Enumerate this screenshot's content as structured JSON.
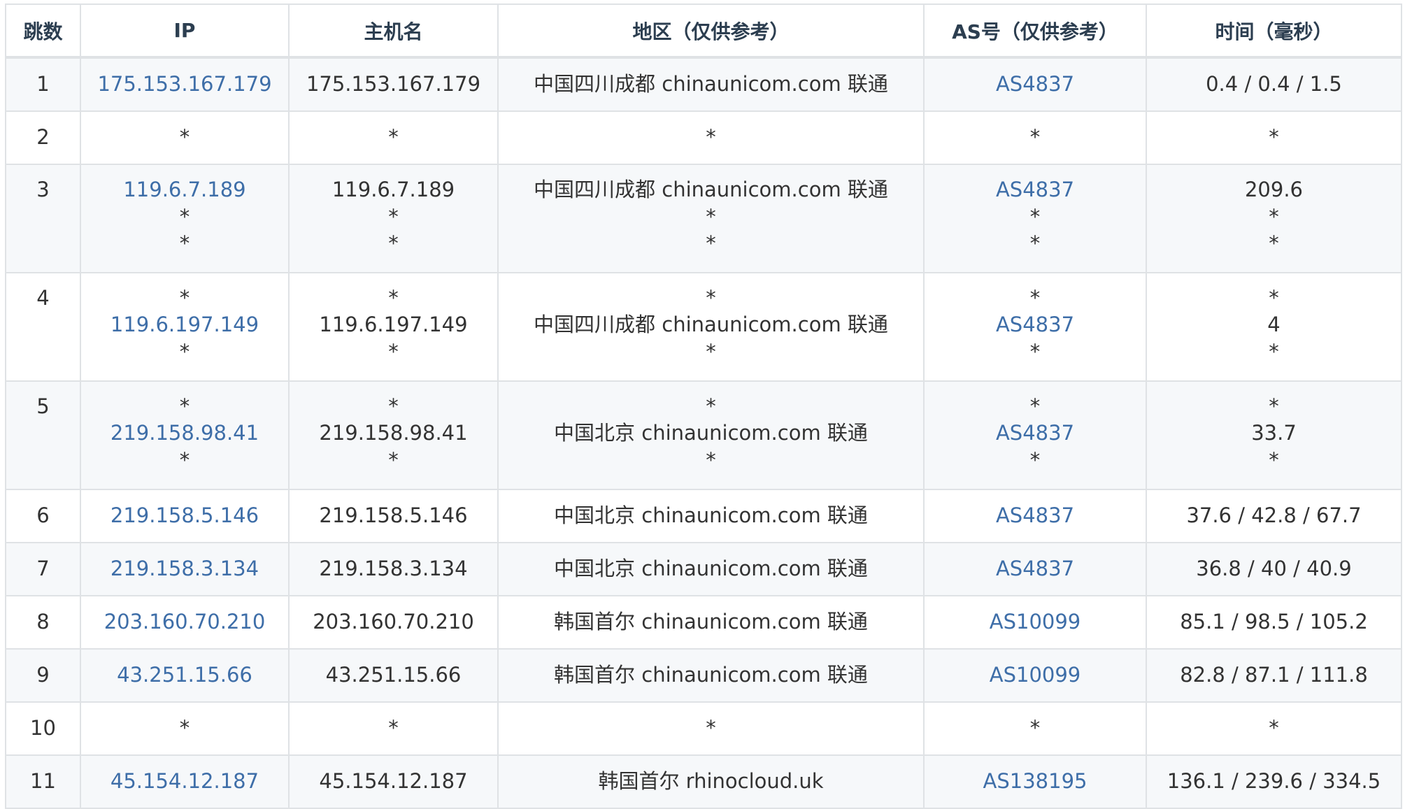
{
  "table": {
    "headers": [
      "跳数",
      "IP",
      "主机名",
      "地区（仅供参考）",
      "AS号（仅供参考）",
      "时间（毫秒）"
    ],
    "rows": [
      {
        "hop": "1",
        "ip": [
          "175.153.167.179"
        ],
        "host": [
          "175.153.167.179"
        ],
        "region": [
          "中国四川成都 chinaunicom.com 联通"
        ],
        "as": [
          "AS4837"
        ],
        "time": [
          "0.4 / 0.4 / 1.5"
        ]
      },
      {
        "hop": "2",
        "ip": [
          "*"
        ],
        "host": [
          "*"
        ],
        "region": [
          "*"
        ],
        "as": [
          "*"
        ],
        "time": [
          "*"
        ]
      },
      {
        "hop": "3",
        "ip": [
          "119.6.7.189",
          "*",
          "*"
        ],
        "host": [
          "119.6.7.189",
          "*",
          "*"
        ],
        "region": [
          "中国四川成都 chinaunicom.com 联通",
          "*",
          "*"
        ],
        "as": [
          "AS4837",
          "*",
          "*"
        ],
        "time": [
          "209.6",
          "*",
          "*"
        ]
      },
      {
        "hop": "4",
        "ip": [
          "*",
          "119.6.197.149",
          "*"
        ],
        "host": [
          "*",
          "119.6.197.149",
          "*"
        ],
        "region": [
          "*",
          "中国四川成都 chinaunicom.com 联通",
          "*"
        ],
        "as": [
          "*",
          "AS4837",
          "*"
        ],
        "time": [
          "*",
          "4",
          "*"
        ]
      },
      {
        "hop": "5",
        "ip": [
          "*",
          "219.158.98.41",
          "*"
        ],
        "host": [
          "*",
          "219.158.98.41",
          "*"
        ],
        "region": [
          "*",
          "中国北京 chinaunicom.com 联通",
          "*"
        ],
        "as": [
          "*",
          "AS4837",
          "*"
        ],
        "time": [
          "*",
          "33.7",
          "*"
        ]
      },
      {
        "hop": "6",
        "ip": [
          "219.158.5.146"
        ],
        "host": [
          "219.158.5.146"
        ],
        "region": [
          "中国北京 chinaunicom.com 联通"
        ],
        "as": [
          "AS4837"
        ],
        "time": [
          "37.6 / 42.8 / 67.7"
        ]
      },
      {
        "hop": "7",
        "ip": [
          "219.158.3.134"
        ],
        "host": [
          "219.158.3.134"
        ],
        "region": [
          "中国北京 chinaunicom.com 联通"
        ],
        "as": [
          "AS4837"
        ],
        "time": [
          "36.8 / 40 / 40.9"
        ]
      },
      {
        "hop": "8",
        "ip": [
          "203.160.70.210"
        ],
        "host": [
          "203.160.70.210"
        ],
        "region": [
          "韩国首尔 chinaunicom.com 联通"
        ],
        "as": [
          "AS10099"
        ],
        "time": [
          "85.1 / 98.5 / 105.2"
        ]
      },
      {
        "hop": "9",
        "ip": [
          "43.251.15.66"
        ],
        "host": [
          "43.251.15.66"
        ],
        "region": [
          "韩国首尔 chinaunicom.com 联通"
        ],
        "as": [
          "AS10099"
        ],
        "time": [
          "82.8 / 87.1 / 111.8"
        ]
      },
      {
        "hop": "10",
        "ip": [
          "*"
        ],
        "host": [
          "*"
        ],
        "region": [
          "*"
        ],
        "as": [
          "*"
        ],
        "time": [
          "*"
        ]
      },
      {
        "hop": "11",
        "ip": [
          "45.154.12.187"
        ],
        "host": [
          "45.154.12.187"
        ],
        "region": [
          "韩国首尔 rhinocloud.uk"
        ],
        "as": [
          "AS138195"
        ],
        "time": [
          "136.1 / 239.6 / 334.5"
        ]
      }
    ]
  },
  "colors": {
    "link": "#3e6ea8",
    "text": "#333333",
    "header_text": "#2c3e50",
    "stripe": "#f6f8fa",
    "border": "#dfe2e5"
  }
}
